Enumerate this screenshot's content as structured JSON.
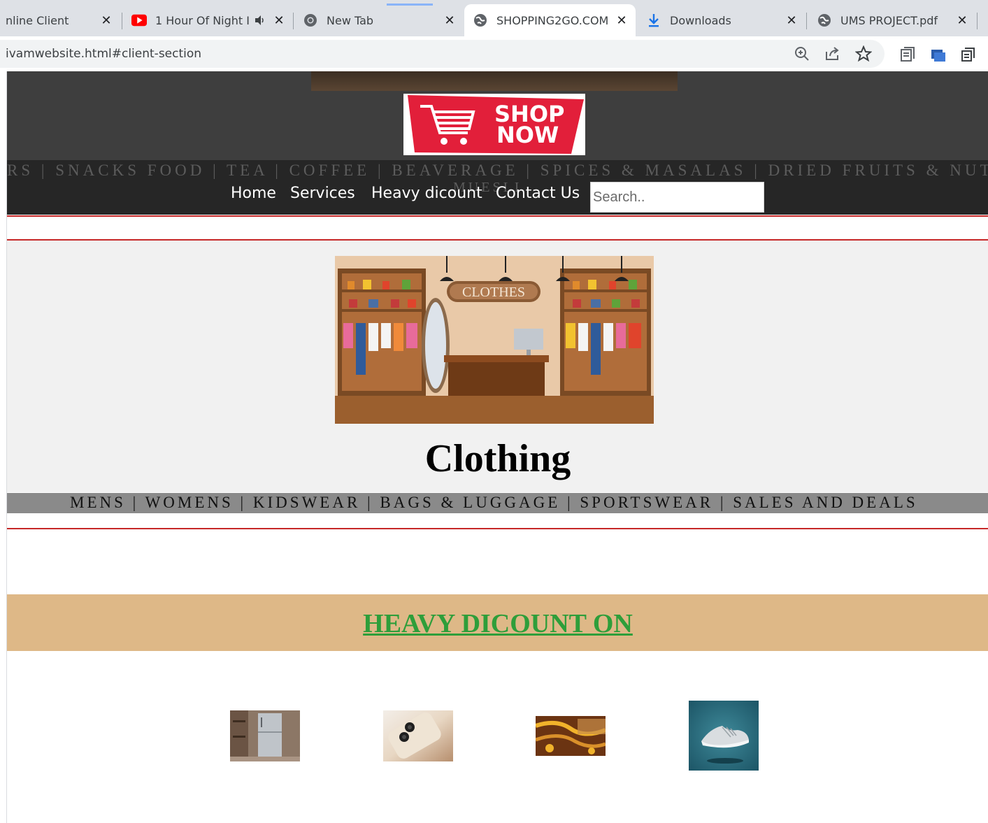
{
  "browser": {
    "tabs": [
      {
        "title": "nline Client",
        "icon": "generic-page-icon"
      },
      {
        "title": "1 Hour Of Night I",
        "icon": "youtube-icon",
        "muted_icon": "speaker-icon"
      },
      {
        "title": "New Tab",
        "icon": "chrome-icon"
      },
      {
        "title": "SHOPPING2GO.COM",
        "icon": "globe-icon",
        "active": true
      },
      {
        "title": "Downloads",
        "icon": "download-icon"
      },
      {
        "title": "UMS PROJECT.pdf",
        "icon": "globe-icon"
      }
    ],
    "close_glyph": "✕",
    "url": "ivamwebsite.html#client-section",
    "toolbar_icons": [
      "zoom-icon",
      "share-icon",
      "bookmark-star-icon",
      "reading-list-icon",
      "extension-icon",
      "tab-search-icon"
    ]
  },
  "site": {
    "logo": {
      "line1": "SHOP",
      "line2": "NOW"
    },
    "marquee": "RS | SNACKS FOOD | TEA | COFFEE | BEAVERAGE | SPICES & MASALAS | DRIED FRUITS & NUT",
    "marquee_overflow": "MUESLI",
    "nav": [
      "Home",
      "Services",
      "Heavy dicount",
      "Contact Us"
    ],
    "search_placeholder": "Search..",
    "category": {
      "image_sign": "CLOTHES",
      "title": "Clothing",
      "subnav": "MENS | WOMENS | KIDSWEAR | BAGS & LUGGAGE | SPORTSWEAR | SALES AND DEALS"
    },
    "discount": {
      "title": "HEAVY DICOUNT ON",
      "products": [
        "refrigerator",
        "smartphone",
        "jewellery",
        "sneaker"
      ]
    }
  },
  "colors": {
    "hero_bg": "#3e3e3e",
    "nav_bg": "#262626",
    "accent_red": "#c62828",
    "logo_red": "#e21f3a",
    "banner_bg": "#deb887",
    "banner_text": "#2e9e3a",
    "section_bg": "#f1f1f1"
  }
}
